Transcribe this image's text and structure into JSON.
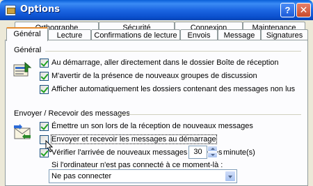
{
  "window": {
    "title": "Options"
  },
  "title_buttons": {
    "help": "?",
    "close": "✕"
  },
  "tabs_back": [
    {
      "label": "Orthographe"
    },
    {
      "label": "Sécurité"
    },
    {
      "label": "Connexion"
    },
    {
      "label": "Maintenance"
    }
  ],
  "tabs_front": [
    {
      "label": "Général"
    },
    {
      "label": "Lecture"
    },
    {
      "label": "Confirmations de lecture"
    },
    {
      "label": "Envois"
    },
    {
      "label": "Message"
    },
    {
      "label": "Signatures"
    }
  ],
  "active_tab": "Général",
  "general": {
    "heading": "Général",
    "options": [
      {
        "label": "Au démarrage, aller directement dans le dossier Boîte de réception",
        "checked": true
      },
      {
        "label": "M'avertir de la présence de nouveaux groupes de discussion",
        "checked": true
      },
      {
        "label": "Afficher automatiquement les dossiers contenant des messages non lus",
        "checked": true
      }
    ]
  },
  "send_receive": {
    "heading": "Envoyer / Recevoir des messages",
    "options": [
      {
        "label": "Émettre un son lors de la réception de nouveaux messages",
        "checked": true
      },
      {
        "label": "Envoyer et recevoir les messages au démarrage",
        "checked": false
      },
      {
        "label": "Vérifier l'arrivée de nouveaux messages toutes les",
        "checked": true
      }
    ],
    "interval_value": "30",
    "interval_unit": "minute(s)",
    "offline_label": "Si l'ordinateur n'est pas connecté à ce moment-là :",
    "offline_selected": "Ne pas connecter"
  },
  "colors": {
    "titlebar": "#0a5fd8",
    "tab_highlight": "#e68b2c",
    "check_mark": "#21a121"
  }
}
